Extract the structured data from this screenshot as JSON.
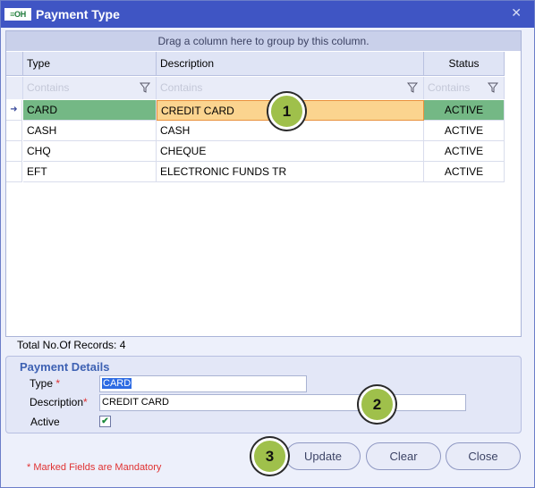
{
  "window": {
    "title": "Payment Type",
    "logo_text": "OH"
  },
  "grid": {
    "group_panel_text": "Drag a column here to group by this column.",
    "columns": [
      "Type",
      "Description",
      "Status"
    ],
    "filter_placeholder": "Contains",
    "rows": [
      {
        "type": "CARD",
        "description": "CREDIT CARD",
        "status": "ACTIVE",
        "selected": true
      },
      {
        "type": "CASH",
        "description": "CASH",
        "status": "ACTIVE"
      },
      {
        "type": "CHQ",
        "description": "CHEQUE",
        "status": "ACTIVE"
      },
      {
        "type": "EFT",
        "description": "ELECTRONIC FUNDS TR",
        "status": "ACTIVE"
      }
    ]
  },
  "records_text": "Total No.Of Records: 4",
  "details": {
    "title": "Payment Details",
    "type_label": "Type",
    "type_value": "CARD",
    "description_label": "Description",
    "description_value": "CREDIT CARD",
    "active_label": "Active",
    "active_checked": true,
    "required_marker": "*"
  },
  "mandatory_note": "* Marked Fields are Mandatory",
  "buttons": {
    "update": "Update",
    "clear": "Clear",
    "close": "Close"
  },
  "badges": [
    "1",
    "2",
    "3"
  ],
  "colors": {
    "titlebar": "#3f55c4",
    "selected_row": "#74b885",
    "selected_cell": "#fbd48f",
    "badge": "#9fc04b",
    "mandatory": "#e03232"
  }
}
